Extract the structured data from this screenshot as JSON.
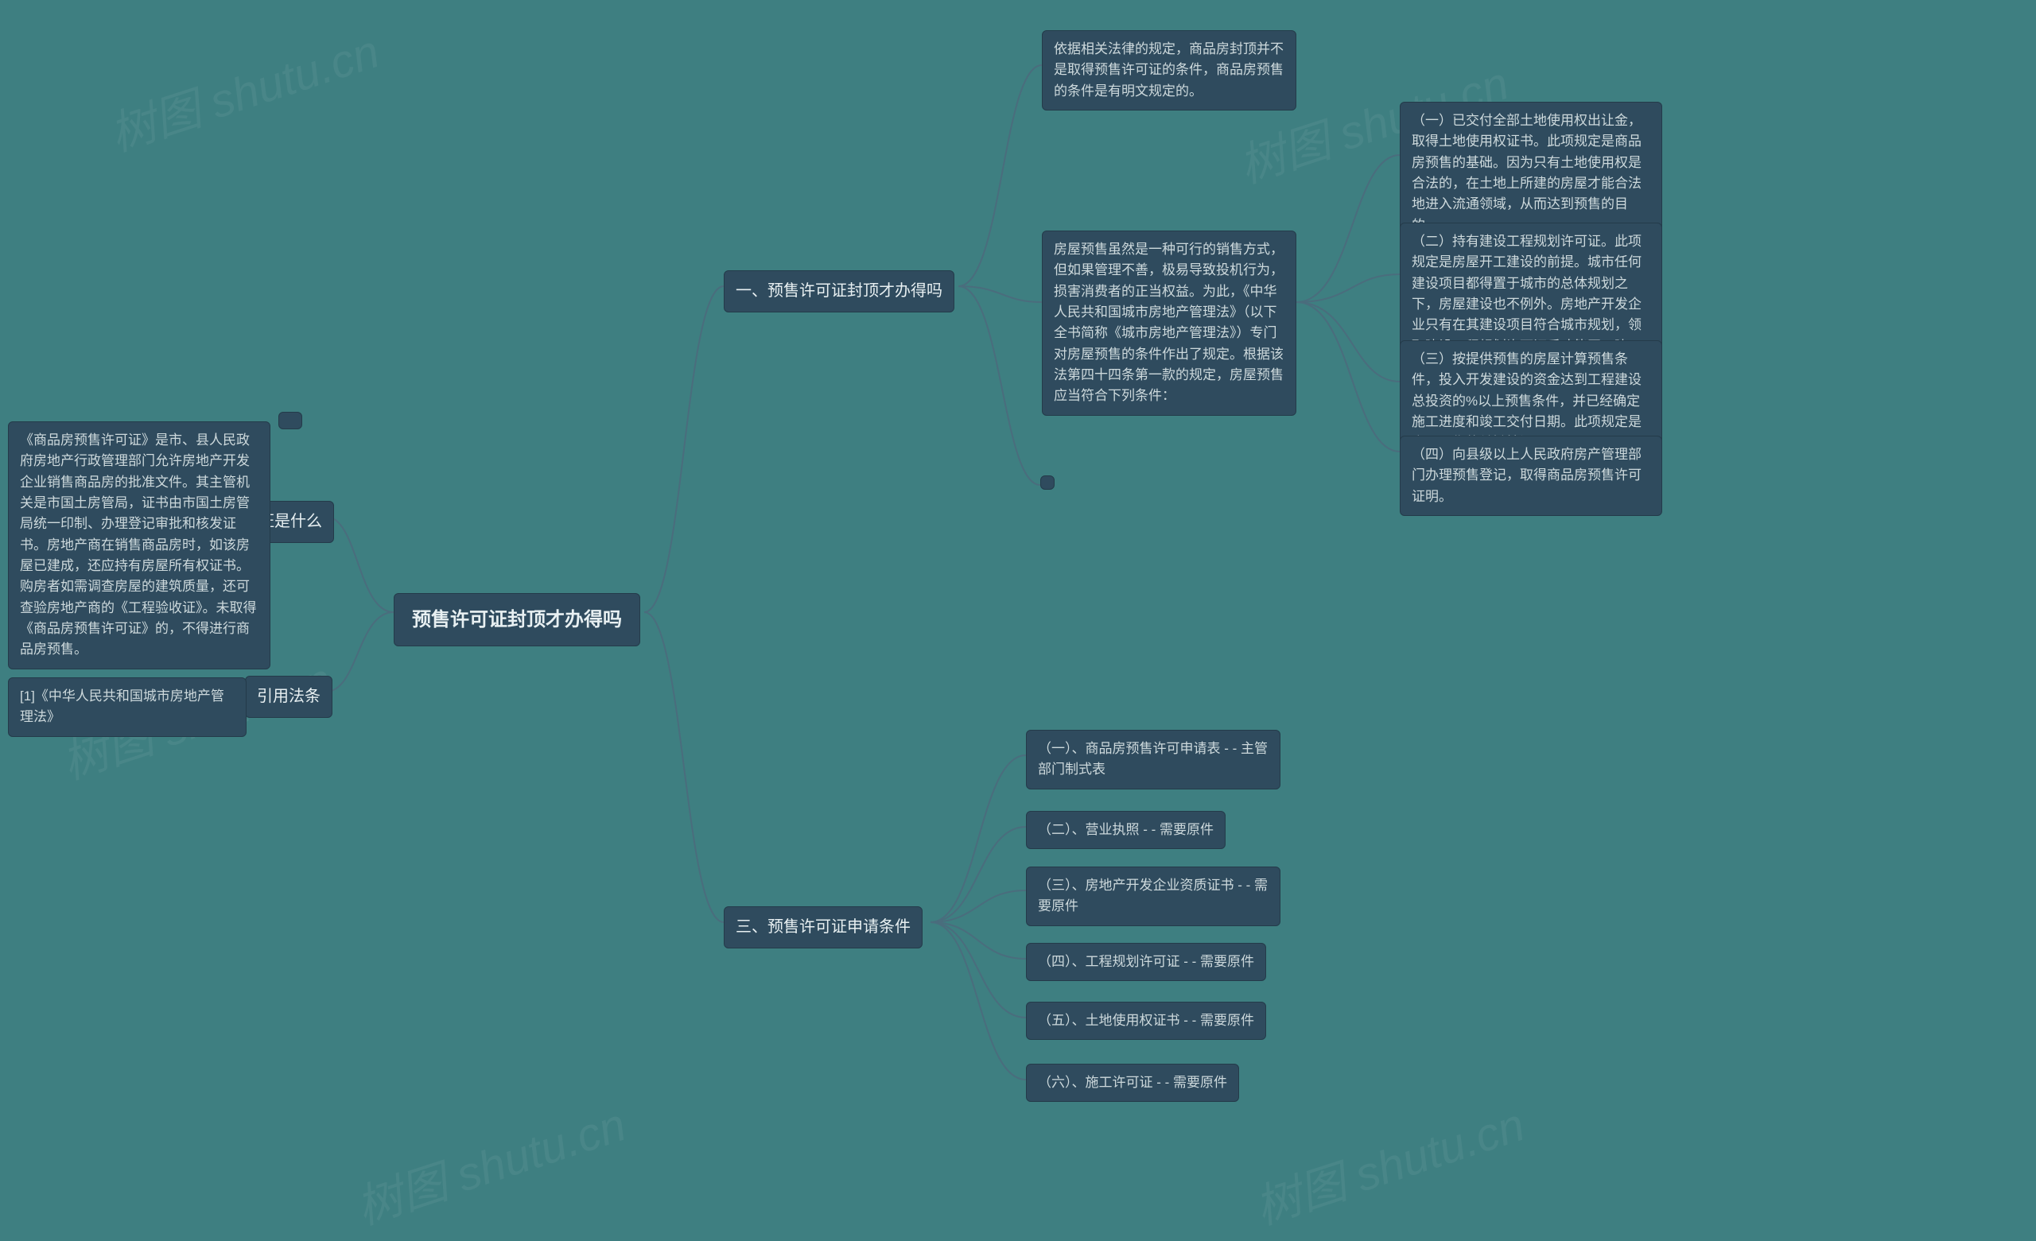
{
  "watermark": "树图 shutu.cn",
  "root": {
    "title": "预售许可证封顶才办得吗"
  },
  "right": {
    "b1": {
      "label": "一、预售许可证封顶才办得吗",
      "n1": "依据相关法律的规定，商品房封顶并不是取得预售许可证的条件，商品房预售的条件是有明文规定的。",
      "n2": "房屋预售虽然是一种可行的销售方式，但如果管理不善，极易导致投机行为，损害消费者的正当权益。为此，《中华人民共和国城市房地产管理法》（以下全书简称《城市房地产管理法》）专门对房屋预售的条件作出了规定。根据该法第四十四条第一款的规定，房屋预售应当符合下列条件：",
      "c1": "（一）已交付全部土地使用权出让金，取得土地使用权证书。此项规定是商品房预售的基础。因为只有土地使用权是合法的，在土地上所建的房屋才能合法地进入流通领域，从而达到预售的目的。",
      "c2": "（二）持有建设工程规划许可证。此项规定是房屋开工建设的前提。城市任何建设项目都得置于城市的总体规划之下，房屋建设也不例外。房地产开发企业只有在其建设项目符合城市规划，领取建设工程规划许可证后才能开工建设。",
      "c3": "（三）按提供预售的房屋计算预售条件，投入开发建设的资金达到工程建设总投资的%以上预售条件，并已经确定施工进度和竣工交付日期。此项规定是房屋预售的关键性问题。",
      "c4": "（四）向县级以上人民政府房产管理部门办理预售登记，取得商品房预售许可证明。"
    },
    "b3": {
      "label": "三、预售许可证申请条件",
      "i1": "（一）、商品房预售许可申请表 - - 主管部门制式表",
      "i2": "（二）、营业执照 - - 需要原件",
      "i3": "（三）、房地产开发企业资质证书 - - 需要原件",
      "i4": "（四）、工程规划许可证 - - 需要原件",
      "i5": "（五）、土地使用权证书 - - 需要原件",
      "i6": "（六）、施工许可证 - - 需要原件"
    }
  },
  "left": {
    "b2": {
      "label": "二、预售许可证是什么",
      "n1": "《商品房预售许可证》是市、县人民政府房地产行政管理部门允许房地产开发企业销售商品房的批准文件。其主管机关是市国土房管局，证书由市国土房管局统一印制、办理登记审批和核发证书。房地产商在销售商品房时，如该房屋已建成，还应持有房屋所有权证书。购房者如需调查房屋的建筑质量，还可查验房地产商的《工程验收证》。未取得《商品房预售许可证》的，不得进行商品房预售。"
    },
    "b4": {
      "label": "引用法条",
      "n1": "[1]《中华人民共和国城市房地产管理法》"
    }
  }
}
